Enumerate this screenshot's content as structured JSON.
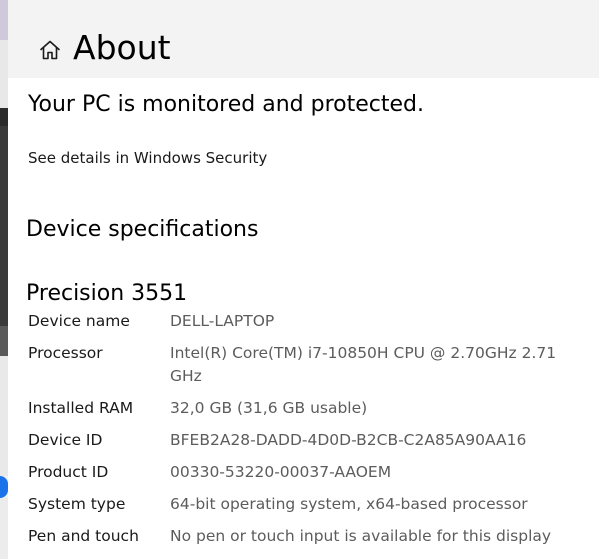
{
  "header": {
    "title": "About",
    "icon": "home-icon"
  },
  "protection": {
    "title": "Your PC is monitored and protected.",
    "link": "See details in Windows Security"
  },
  "specs": {
    "heading": "Device specifications",
    "model": "Precision 3551",
    "rows": [
      {
        "label": "Device name",
        "value": "DELL-LAPTOP"
      },
      {
        "label": "Processor",
        "value": "Intel(R) Core(TM) i7-10850H CPU @ 2.70GHz   2.71 GHz"
      },
      {
        "label": "Installed RAM",
        "value": "32,0 GB (31,6 GB usable)"
      },
      {
        "label": "Device ID",
        "value": "BFEB2A28-DADD-4D0D-B2CB-C2A85A90AA16"
      },
      {
        "label": "Product ID",
        "value": "00330-53220-00037-AAOEM"
      },
      {
        "label": "System type",
        "value": "64-bit operating system, x64-based processor"
      },
      {
        "label": "Pen and touch",
        "value": "No pen or touch input is available for this display"
      }
    ]
  },
  "colors": {
    "header_bg": "#f3f3f3",
    "label_text": "#1a1a1a",
    "value_text": "#5c5c5c"
  }
}
